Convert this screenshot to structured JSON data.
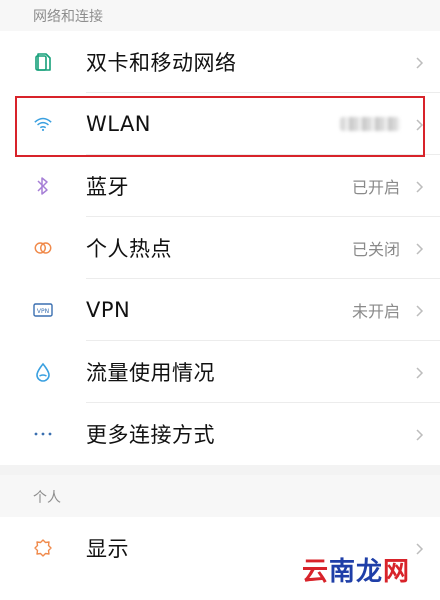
{
  "sections": [
    {
      "title": "网络和连接",
      "items": [
        {
          "label": "双卡和移动网络",
          "value": "",
          "icon": "sim-card-icon"
        },
        {
          "label": "WLAN",
          "value": "",
          "icon": "wifi-icon",
          "value_redacted": true
        },
        {
          "label": "蓝牙",
          "value": "已开启",
          "icon": "bluetooth-icon"
        },
        {
          "label": "个人热点",
          "value": "已关闭",
          "icon": "hotspot-icon"
        },
        {
          "label": "VPN",
          "value": "未开启",
          "icon": "vpn-icon"
        },
        {
          "label": "流量使用情况",
          "value": "",
          "icon": "data-usage-icon"
        },
        {
          "label": "更多连接方式",
          "value": "",
          "icon": "more-icon"
        }
      ]
    },
    {
      "title": "个人",
      "items": [
        {
          "label": "显示",
          "value": "",
          "icon": "display-icon"
        }
      ]
    }
  ],
  "colors": {
    "accent_blue": "#3aa0e0",
    "selection_red": "#d8232a",
    "hotspot_orange": "#f08a4b",
    "bluetooth_purple": "#a67fd6"
  },
  "watermark": {
    "chars": [
      "云",
      "南",
      "龙",
      "网"
    ]
  }
}
